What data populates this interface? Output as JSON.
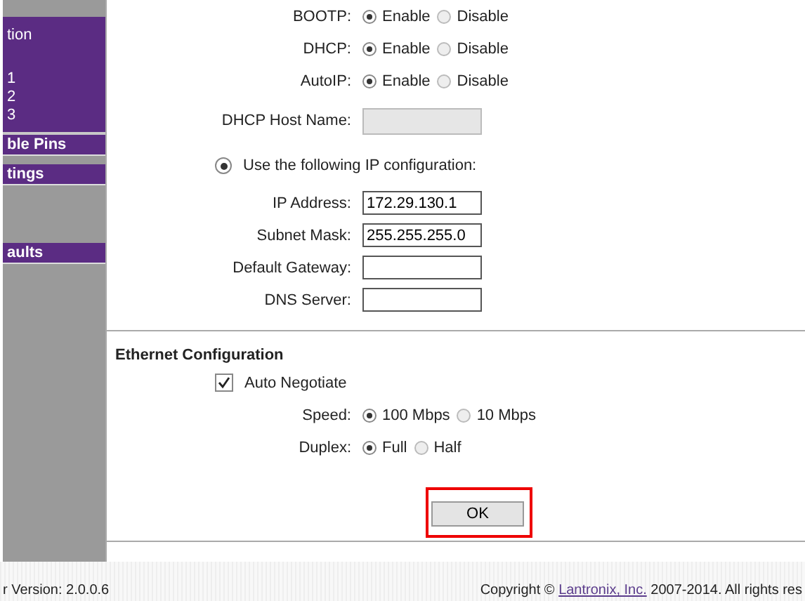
{
  "sidebar": {
    "items": [
      {
        "label": "tion",
        "kind": "link"
      },
      {
        "label": "1",
        "kind": "link"
      },
      {
        "label": "2",
        "kind": "link"
      },
      {
        "label": "3",
        "kind": "link"
      },
      {
        "label": "ble Pins",
        "kind": "header"
      },
      {
        "label": "tings",
        "kind": "header"
      },
      {
        "label": "aults",
        "kind": "header"
      }
    ]
  },
  "network": {
    "rows": [
      {
        "kind": "radio",
        "label": "BOOTP:",
        "options": [
          {
            "label": "Enable",
            "selected": true
          },
          {
            "label": "Disable",
            "selected": false
          }
        ]
      },
      {
        "kind": "radio",
        "label": "DHCP:",
        "options": [
          {
            "label": "Enable",
            "selected": true
          },
          {
            "label": "Disable",
            "selected": false
          }
        ]
      },
      {
        "kind": "radio",
        "label": "AutoIP:",
        "options": [
          {
            "label": "Enable",
            "selected": true
          },
          {
            "label": "Disable",
            "selected": false
          }
        ]
      },
      {
        "kind": "field",
        "label": "DHCP Host Name:",
        "value": "",
        "disabled": true
      },
      {
        "kind": "choice",
        "label": "Use the following IP configuration:",
        "selected": true
      },
      {
        "kind": "field",
        "label": "IP Address:",
        "value": "172.29.130.1",
        "disabled": false
      },
      {
        "kind": "field",
        "label": "Subnet Mask:",
        "value": "255.255.255.0",
        "disabled": false
      },
      {
        "kind": "field",
        "label": "Default Gateway:",
        "value": "",
        "disabled": false
      },
      {
        "kind": "field",
        "label": "DNS Server:",
        "value": "",
        "disabled": false
      }
    ]
  },
  "ethernet": {
    "title": "Ethernet Configuration",
    "rows": [
      {
        "kind": "checkbox",
        "label": "Auto Negotiate",
        "checked": true
      },
      {
        "kind": "radio",
        "label": "Speed:",
        "options": [
          {
            "label": "100 Mbps",
            "selected": true
          },
          {
            "label": "10 Mbps",
            "selected": false
          }
        ]
      },
      {
        "kind": "radio",
        "label": "Duplex:",
        "options": [
          {
            "label": "Full",
            "selected": true
          },
          {
            "label": "Half",
            "selected": false
          }
        ]
      }
    ]
  },
  "ok_button": {
    "label": "OK",
    "highlighted": true
  },
  "footer": {
    "version": "r Version: 2.0.0.6",
    "copyright_prefix": "Copyright ©",
    "link": "Lantronix, Inc.",
    "copyright_suffix": "2007-2014. All rights res"
  }
}
